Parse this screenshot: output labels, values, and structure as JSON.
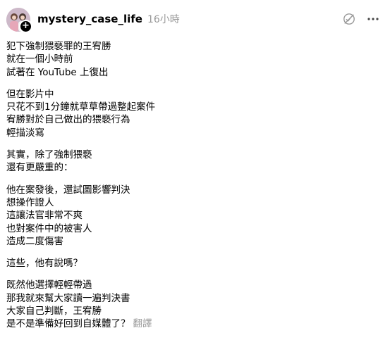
{
  "post": {
    "username": "mystery_case_life",
    "timestamp": "16小時",
    "follow_badge": "+",
    "paragraphs": [
      [
        "犯下強制猥褻罪的王宥勝",
        "就在一個小時前",
        "試著在 YouTube 上復出"
      ],
      [
        "但在影片中",
        "只花不到1分鐘就草草帶過整起案件",
        "宥勝對於自己做出的猥褻行為",
        "輕描淡寫"
      ],
      [
        "其實，除了強制猥褻",
        "還有更嚴重的："
      ],
      [
        "他在案發後，還試圖影響判決",
        "想操作證人",
        "這讓法官非常不爽",
        "也對案件中的被害人",
        "造成二度傷害"
      ],
      [
        "這些，他有說嗎？"
      ],
      [
        "既然他選擇輕輕帶過",
        "那我就來幫大家讀一遍判決書",
        "大家自己判斷，王宥勝",
        "是不是準備好回到自媒體了？"
      ]
    ],
    "translate_label": "翻譯",
    "icons": {
      "avatar": "avatar-photo",
      "follow": "plus-icon",
      "activity": "activity-slash-icon",
      "more": "more-horizontal-icon"
    },
    "colors": {
      "text": "#000000",
      "muted": "#999999",
      "background": "#ffffff"
    }
  }
}
